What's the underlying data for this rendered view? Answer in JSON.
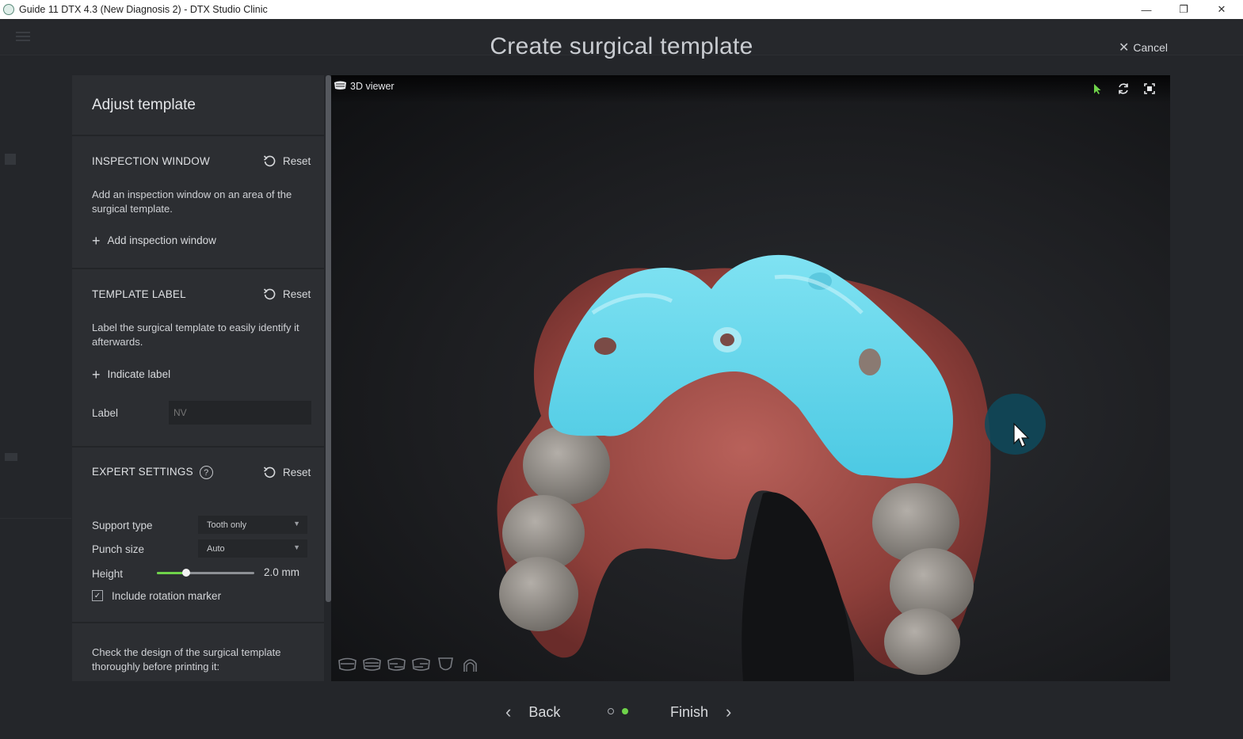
{
  "window": {
    "title": "Guide 11 DTX 4.3 (New Diagnosis 2) - DTX Studio Clinic",
    "minimize_glyph": "—",
    "maximize_glyph": "❐",
    "close_glyph": "✕"
  },
  "header": {
    "title": "Create surgical template",
    "cancel_label": "Cancel"
  },
  "panel": {
    "title": "Adjust template",
    "inspection_window": {
      "heading": "INSPECTION WINDOW",
      "reset_label": "Reset",
      "description": "Add an inspection window on an area of the surgical template.",
      "add_label": "Add inspection window"
    },
    "template_label": {
      "heading": "TEMPLATE LABEL",
      "reset_label": "Reset",
      "description": "Label the surgical template to easily identify it afterwards.",
      "add_label": "Indicate label",
      "field_label": "Label",
      "field_value": "NV"
    },
    "expert_settings": {
      "heading": "EXPERT SETTINGS",
      "help_glyph": "?",
      "reset_label": "Reset",
      "support_type_label": "Support type",
      "support_type_value": "Tooth only",
      "punch_size_label": "Punch size",
      "punch_size_value": "Auto",
      "height_label": "Height",
      "height_value": "2.0 mm",
      "height_slider_fraction": 0.3,
      "rotation_marker_label": "Include rotation marker",
      "rotation_marker_checked": true
    },
    "bottom_note": "Check the design of the surgical template thoroughly before printing it:"
  },
  "viewer": {
    "label": "3D viewer",
    "tools": [
      "select-arrow-icon",
      "rotate-icon",
      "fit-to-screen-icon"
    ],
    "view_presets": [
      "view-front-icon",
      "view-back-icon",
      "view-left-icon",
      "view-right-icon",
      "view-upper-icon",
      "view-lower-icon"
    ]
  },
  "nav": {
    "back_label": "Back",
    "finish_label": "Finish",
    "step_count": 2,
    "current_step": 2
  },
  "colors": {
    "accent_green": "#6fd34a",
    "template_cyan": "#5fd3ea",
    "gum": "#9b4a45",
    "tooth": "#8e8a85"
  }
}
